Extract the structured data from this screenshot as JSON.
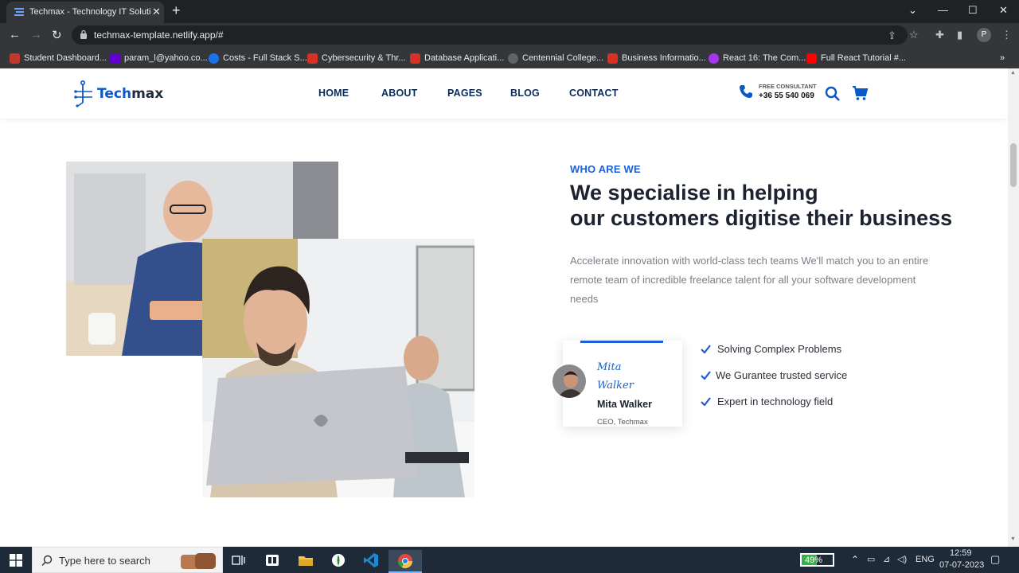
{
  "browser": {
    "tab_title": "Techmax - Technology IT Solution",
    "url": "techmax-template.netlify.app/#",
    "profile_initial": "P",
    "bookmarks": [
      {
        "label": "Student Dashboard...",
        "color": "#c0392b"
      },
      {
        "label": "param_l@yahoo.co...",
        "color": "#6001d2"
      },
      {
        "label": "Costs - Full Stack S...",
        "color": "#1a73e8"
      },
      {
        "label": "Cybersecurity & Thr...",
        "color": "#d93025"
      },
      {
        "label": "Database Applicati...",
        "color": "#d93025"
      },
      {
        "label": "Centennial College...",
        "color": "#5f6368"
      },
      {
        "label": "Business Informatio...",
        "color": "#d93025"
      },
      {
        "label": "React 16: The Com...",
        "color": "#a435f0"
      },
      {
        "label": "Full React Tutorial #...",
        "color": "#ff0000"
      }
    ]
  },
  "site": {
    "logo_text_a": "Tech",
    "logo_text_b": "max",
    "nav": [
      "HOME",
      "ABOUT",
      "PAGES",
      "BLOG",
      "CONTACT"
    ],
    "consult_label": "FREE CONSULTANT",
    "consult_phone": "+36 55 540 069",
    "brand_color": "#1c5fd6"
  },
  "about": {
    "eyebrow": "WHO ARE WE",
    "headline_line1": "We specialise in helping",
    "headline_line2": "our customers digitise their business",
    "description": "Accelerate innovation with world-class tech teams We'll match you to an entire remote team of incredible freelance talent for all your software development needs",
    "signature": "Mita Walker",
    "ceo_name": "Mita Walker",
    "ceo_role": "CEO, Techmax",
    "features": [
      "Solving Complex Problems",
      "We Gurantee trusted service",
      "Expert in technology field"
    ]
  },
  "taskbar": {
    "search_placeholder": "Type here to search",
    "battery_percent": 49,
    "battery_label": "49%",
    "language": "ENG",
    "time": "12:59",
    "date": "07-07-2023"
  }
}
